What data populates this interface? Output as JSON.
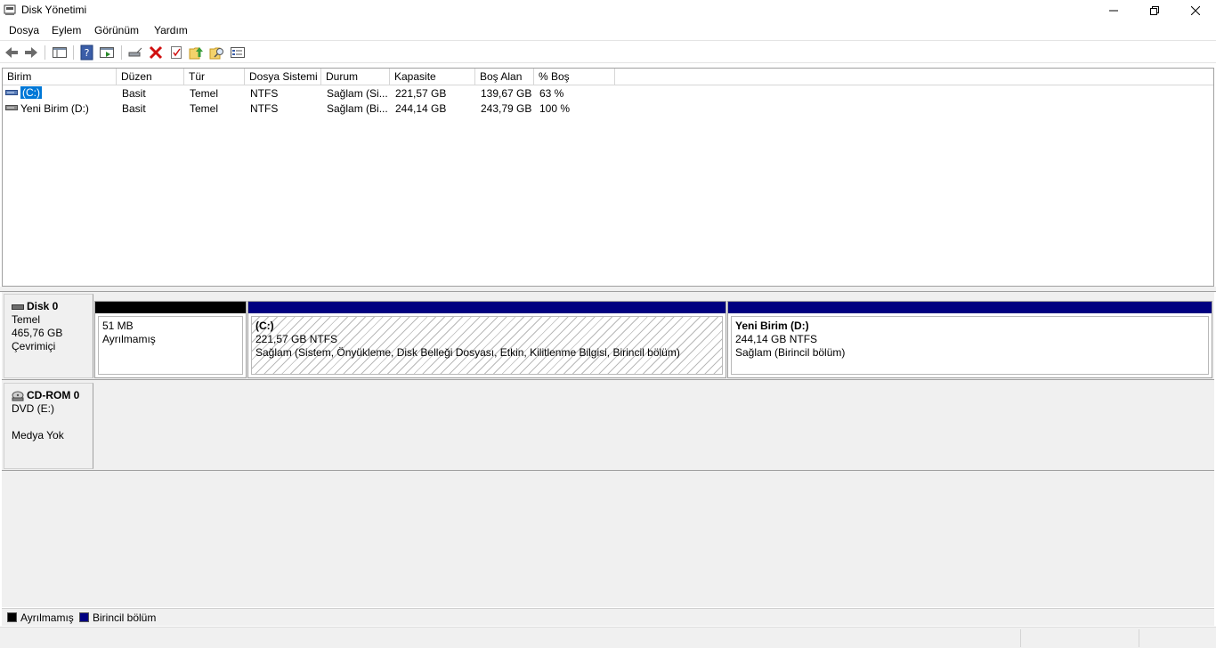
{
  "window": {
    "title": "Disk Yönetimi"
  },
  "menu": [
    {
      "label": "Dosya"
    },
    {
      "label": "Eylem"
    },
    {
      "label": "Görünüm"
    },
    {
      "label": "Yardım"
    }
  ],
  "toolbar": {
    "buttons": [
      "back-icon",
      "forward-icon",
      "console-tree-icon",
      "help-icon",
      "properties-view-icon",
      "connect-disk-icon",
      "delete-icon",
      "checklist-icon",
      "folder-up-icon",
      "folder-search-icon",
      "settings-list-icon"
    ]
  },
  "volume_list": {
    "columns": [
      "Birim",
      "Düzen",
      "Tür",
      "Dosya Sistemi",
      "Durum",
      "Kapasite",
      "Boş Alan",
      "% Boş"
    ],
    "rows": [
      {
        "name": "(C:)",
        "layout": "Basit",
        "type": "Temel",
        "fs": "NTFS",
        "status": "Sağlam (Si...",
        "capacity": "221,57 GB",
        "free": "139,67 GB",
        "pct": "63 %",
        "selected": true
      },
      {
        "name": "Yeni Birim (D:)",
        "layout": "Basit",
        "type": "Temel",
        "fs": "NTFS",
        "status": "Sağlam (Bi...",
        "capacity": "244,14 GB",
        "free": "243,79 GB",
        "pct": "100 %",
        "selected": false
      }
    ]
  },
  "disks": [
    {
      "name": "Disk 0",
      "type": "Temel",
      "size": "465,76 GB",
      "state": "Çevrimiçi",
      "partitions": [
        {
          "title": "",
          "line1": "51 MB",
          "line2": "Ayrılmamış",
          "kind": "unallocated"
        },
        {
          "title": "(C:)",
          "line1": "221,57 GB NTFS",
          "line2": "Sağlam (Sistem, Önyükleme, Disk Belleği Dosyası, Etkin, Kilitlenme Bilgisi, Birincil bölüm)",
          "kind": "primary"
        },
        {
          "title": "Yeni Birim  (D:)",
          "line1": "244,14 GB NTFS",
          "line2": "Sağlam (Birincil bölüm)",
          "kind": "primary"
        }
      ]
    },
    {
      "name": "CD-ROM 0",
      "type": "DVD (E:)",
      "state": "Medya Yok"
    }
  ],
  "legend": [
    {
      "label": "Ayrılmamış",
      "color": "#000000"
    },
    {
      "label": "Birincil bölüm",
      "color": "#000080"
    }
  ],
  "colors": {
    "primary_bar": "#000080",
    "unallocated_bar": "#000000",
    "selection": "#0078d7"
  }
}
